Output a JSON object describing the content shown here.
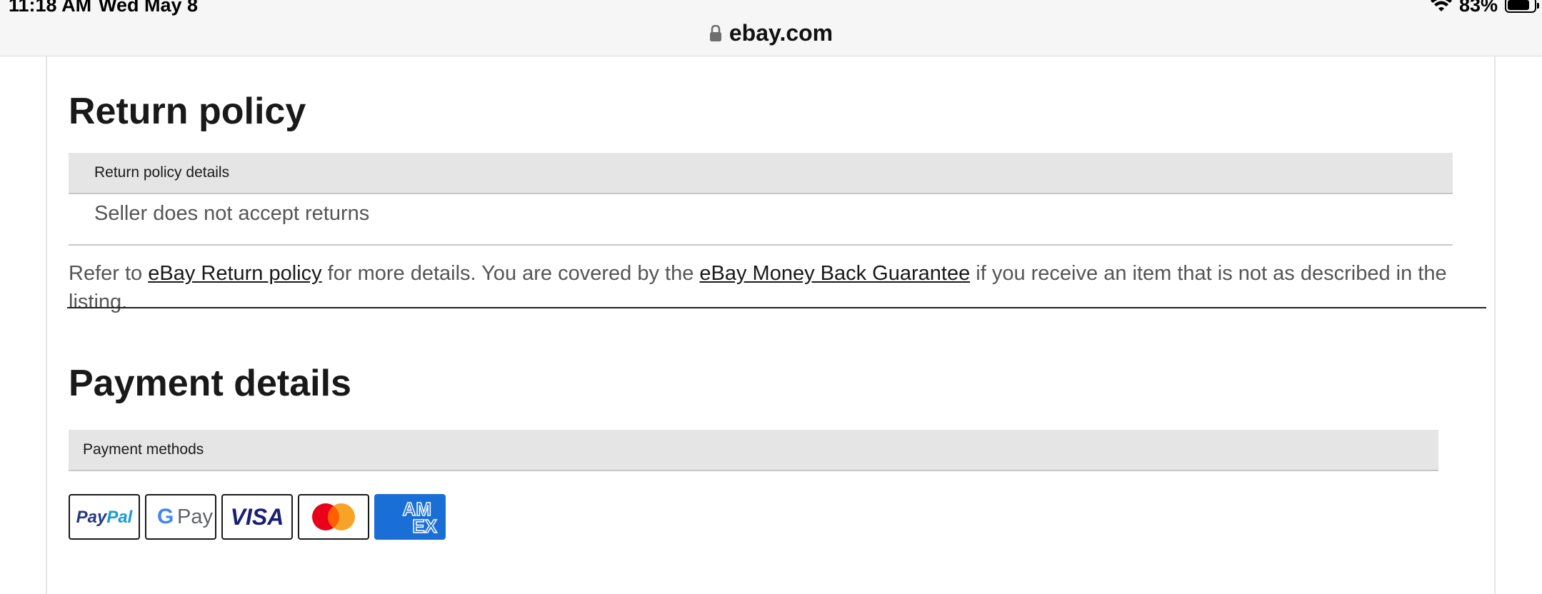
{
  "status_bar": {
    "time": "11:18 AM",
    "date": "Wed May 8",
    "battery": "83%",
    "icons": [
      "wifi-icon",
      "battery-icon"
    ]
  },
  "address_bar": {
    "domain": "ebay.com",
    "icon": "lock-icon"
  },
  "return_policy": {
    "title": "Return policy",
    "table_header": "Return policy details",
    "value": "Seller does not accept returns",
    "refer_prefix": "Refer to ",
    "return_link": "eBay Return policy",
    "refer_middle": " for more details. You are covered by the ",
    "guarantee_link": "eBay Money Back Guarantee",
    "refer_suffix": " if you receive an item that is not as described in the listing."
  },
  "payment_details": {
    "title": "Payment details",
    "table_header": "Payment methods",
    "methods": [
      {
        "name": "PayPal",
        "icon": "paypal-icon",
        "text": "PayPal"
      },
      {
        "name": "Google Pay",
        "icon": "google-pay-icon",
        "text": "Pay"
      },
      {
        "name": "Visa",
        "icon": "visa-icon",
        "text": "VISA"
      },
      {
        "name": "Mastercard",
        "icon": "mastercard-icon"
      },
      {
        "name": "American Express",
        "icon": "amex-icon",
        "text": "AM EX"
      }
    ]
  },
  "colors": {
    "header_bg": "#e5e5e5",
    "text": "#191919",
    "muted_text": "#555555",
    "amex_blue": "#1a6fd6",
    "visa_blue": "#1a1f71",
    "paypal_dark": "#253b80",
    "paypal_light": "#179bd7",
    "mc_red": "#eb001b",
    "mc_orange": "#f79e1b"
  }
}
